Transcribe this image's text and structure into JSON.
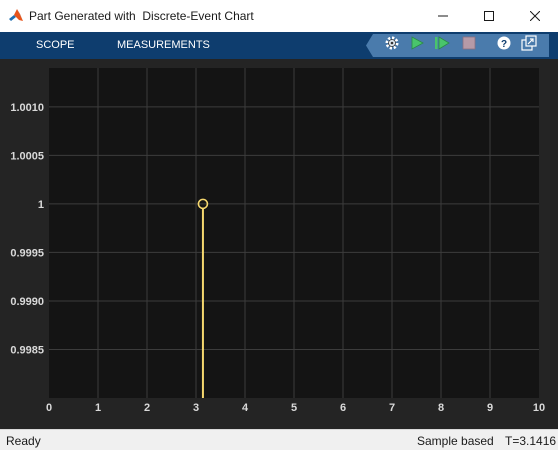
{
  "window": {
    "title": "Part Generated with  Discrete-Event Chart",
    "app_icon": "matlab-logo-icon",
    "controls": [
      "minimize-icon",
      "maximize-icon",
      "close-icon"
    ]
  },
  "toolstrip": {
    "tabs": [
      {
        "label": "SCOPE"
      },
      {
        "label": "MEASUREMENTS"
      }
    ],
    "tools": [
      {
        "icon": "settings-gear-icon"
      },
      {
        "icon": "run-icon"
      },
      {
        "icon": "step-forward-icon"
      },
      {
        "icon": "stop-icon"
      },
      {
        "icon": "help-icon"
      },
      {
        "icon": "undock-icon"
      }
    ],
    "colors": {
      "bar": "#0e3d6e",
      "tool_group": "#4a7bac",
      "run": "#49c46b",
      "stop": "#b69aa7"
    }
  },
  "status": {
    "state": "Ready",
    "mode": "Sample based",
    "time": "T=3.1416"
  },
  "chart_data": {
    "type": "scatter",
    "style": "stem",
    "series": [
      {
        "x": [
          3.1416
        ],
        "y": [
          1
        ],
        "color": "#f5d76e"
      }
    ],
    "xlim": [
      0,
      10
    ],
    "ylim": [
      0.998,
      1.0014
    ],
    "x_ticks": [
      "0",
      "1",
      "2",
      "3",
      "4",
      "5",
      "6",
      "7",
      "8",
      "9",
      "10"
    ],
    "y_ticks": [
      "1.0010",
      "1.0005",
      "1",
      "0.9995",
      "0.9990",
      "0.9985"
    ],
    "y_tick_values": [
      1.001,
      1.0005,
      1,
      0.9995,
      0.999,
      0.9985
    ],
    "grid": true,
    "colors": {
      "axes_bg": "#141414",
      "figure_bg": "#242424",
      "grid": "#3c3c3c",
      "tick_label": "#d9d9d9"
    }
  }
}
